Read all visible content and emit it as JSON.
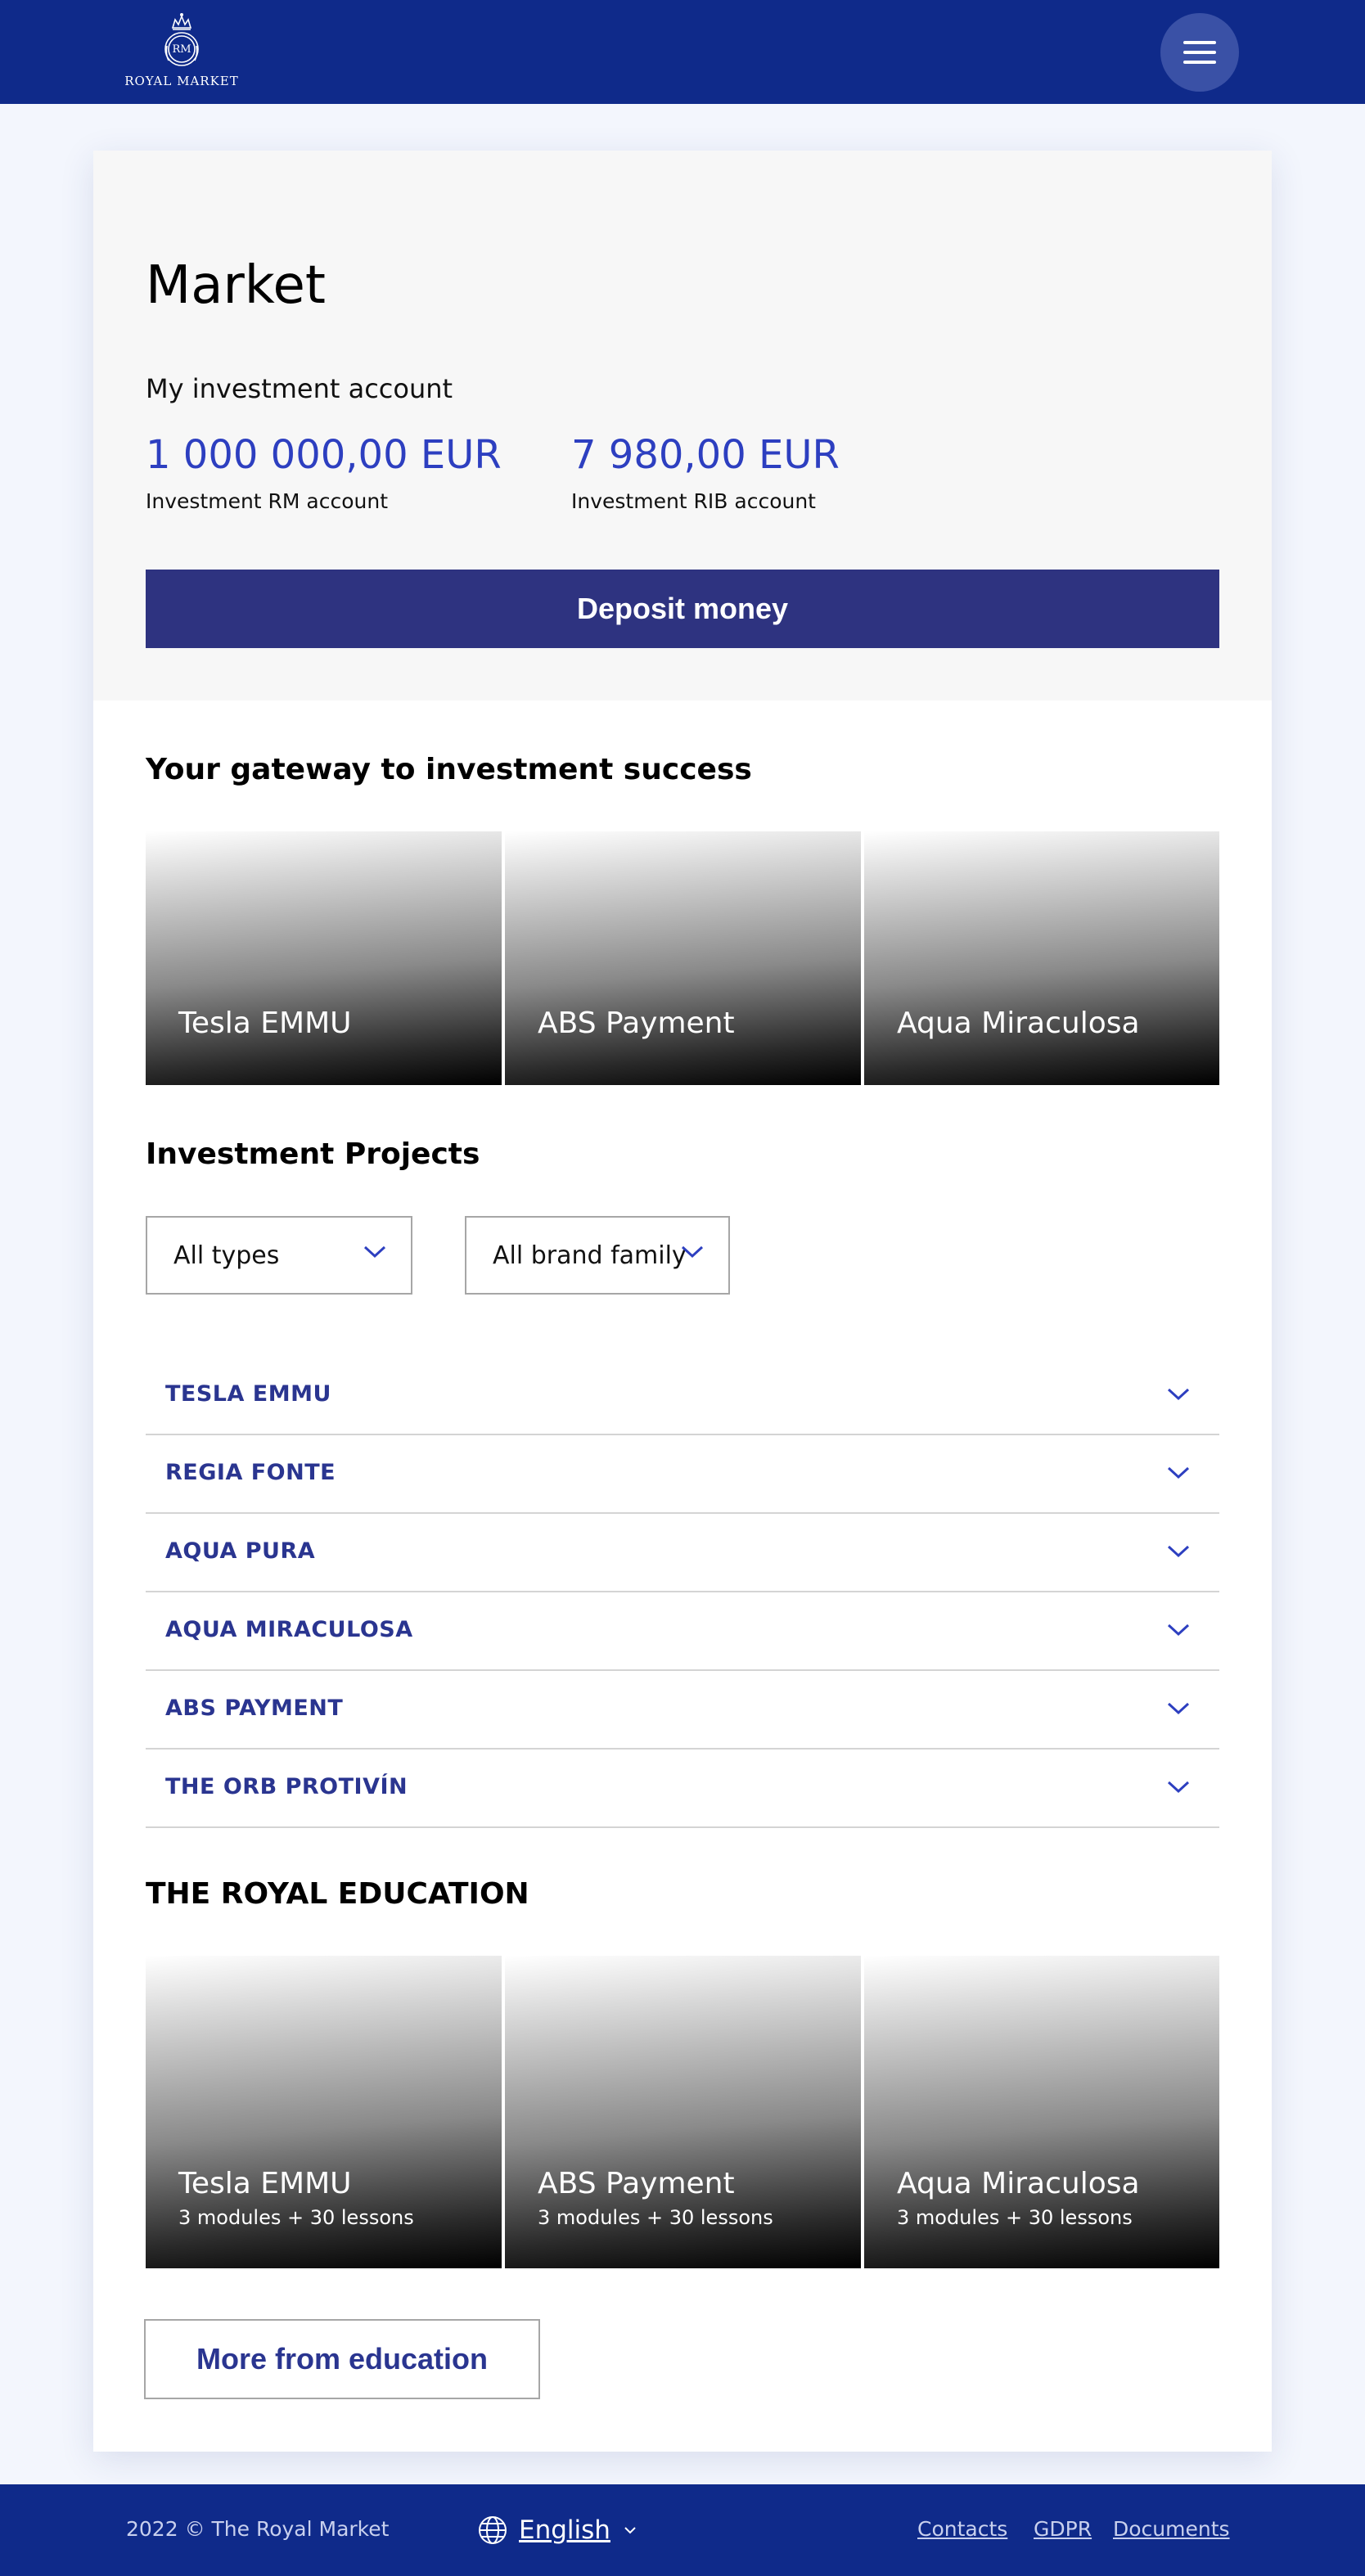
{
  "header": {
    "logo_monogram": "RM",
    "logo_text": "ROYAL MARKET",
    "menu_icon": "hamburger-icon"
  },
  "market": {
    "title": "Market",
    "account_heading": "My investment account",
    "accounts": [
      {
        "amount": "1 000 000,00 EUR",
        "label": "Investment RM account"
      },
      {
        "amount": "7 980,00 EUR",
        "label": "Investment RIB account"
      }
    ],
    "deposit_label": "Deposit money"
  },
  "gateway": {
    "title": "Your gateway to investment success",
    "tiles": [
      {
        "title": "Tesla EMMU"
      },
      {
        "title": "ABS Payment"
      },
      {
        "title": "Aqua Miraculosa"
      }
    ]
  },
  "projects": {
    "title": "Investment Projects",
    "filters": [
      {
        "value": "All types",
        "icon": "chevron-down-icon"
      },
      {
        "value": "All brand family",
        "icon": "chevron-down-icon"
      }
    ],
    "items": [
      {
        "label": "TESLA EMMU"
      },
      {
        "label": "REGIA FONTE"
      },
      {
        "label": "AQUA PURA"
      },
      {
        "label": "AQUA MIRACULOSA"
      },
      {
        "label": "ABS PAYMENT"
      },
      {
        "label": "THE ORB PROTIVÍN"
      }
    ]
  },
  "education": {
    "title": "THE ROYAL EDUCATION",
    "tiles": [
      {
        "title": "Tesla EMMU",
        "subtitle": "3 modules + 30 lessons"
      },
      {
        "title": "ABS Payment",
        "subtitle": "3 modules + 30 lessons"
      },
      {
        "title": "Aqua Miraculosa",
        "subtitle": "3 modules + 30 lessons"
      }
    ],
    "more_label": "More from education"
  },
  "footer": {
    "copyright": "2022 © The Royal Market",
    "language": "English",
    "links": [
      "Contacts",
      "GDPR",
      "Documents"
    ]
  },
  "colors": {
    "header_bg": "#0f2a8a",
    "accent_blue": "#2d3fc0",
    "button_navy": "#2e3380",
    "accordion_text": "#2a3590"
  }
}
